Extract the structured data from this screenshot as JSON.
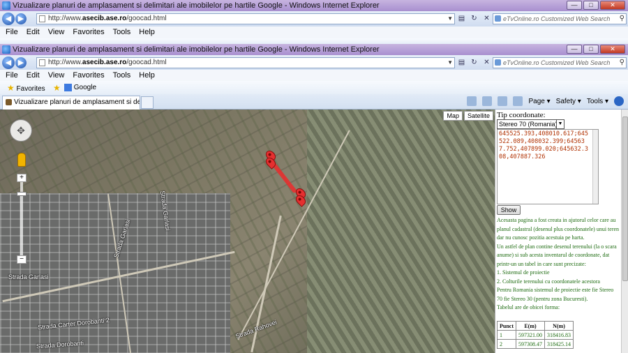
{
  "window": {
    "title": "Vizualizare planuri de amplasament si delimitari ale imobilelor pe hartile Google - Windows Internet Explorer"
  },
  "address": {
    "url_prefix": "http://www.",
    "url_domain": "asecib.ase.ro",
    "url_path": "/goocad.html"
  },
  "search": {
    "placeholder": "eTvOnline.ro Customized Web Search"
  },
  "menu": [
    "File",
    "Edit",
    "View",
    "Favorites",
    "Tools",
    "Help"
  ],
  "favorites": {
    "label": "Favorites",
    "google": "Google"
  },
  "tab": {
    "label": "Vizualizare planuri de amplasament si delimitari a..."
  },
  "commandbar": {
    "page": "Page",
    "safety": "Safety",
    "tools": "Tools"
  },
  "map": {
    "types": [
      "Map",
      "Satellite"
    ],
    "streets": [
      "Strada Garlasi",
      "Strada Garlasi",
      "Strada Carter Dorobanti 2",
      "Strada Dorobanti",
      "Strada Rahovei",
      "Strada Garlasi"
    ]
  },
  "panel": {
    "heading": "Tip coordonate:",
    "selected_system": "Stereo 70 (Romania)",
    "coordinates_text": "645525.393,408010.617;645522.089,408032.399;645637.752,407899.020;645632.308,407887.326",
    "show_button": "Show",
    "description": [
      "Acesasta pagina a fost creata in ajutorul celor care au planul cadastral (desenul plus coordonatele) unui teren dar nu cunosc pozitia acestuia pe harta.",
      "Un astfel de plan contine desenul terenului (la o scara anume) si sub acesta inventarul de coordonate, dat printr-un un tabel in care sunt precizate:",
      "1. Sistemul de proiectie",
      "2. Colturile terenului cu coordonatele acestora",
      "Pentru Romania sistemul de proiectie este fie Stereo 70 fie Stereo 30 (pentru zona Bucuresti).",
      "Tabelul are de obicei forma:"
    ],
    "table": {
      "headers": [
        "Punct",
        "E(m)",
        "N(m)"
      ],
      "rows": [
        [
          "1",
          "597321.00",
          "318416.83"
        ],
        [
          "2",
          "597308.47",
          "318425.14"
        ]
      ]
    }
  }
}
